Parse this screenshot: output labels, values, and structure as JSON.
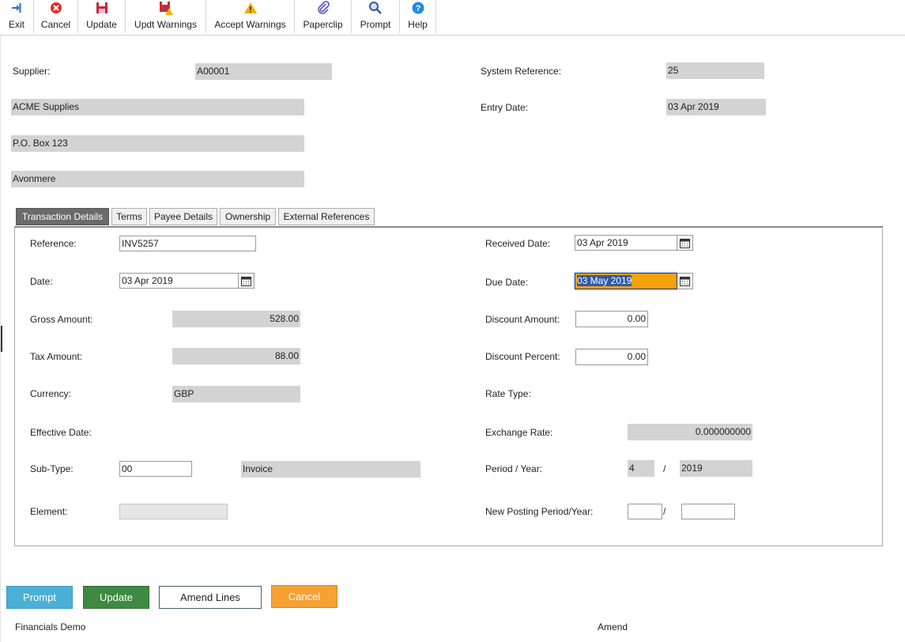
{
  "toolbar": {
    "exit": "Exit",
    "cancel": "Cancel",
    "update": "Update",
    "updt_warnings": "Updt Warnings",
    "accept_warnings": "Accept Warnings",
    "paperclip": "Paperclip",
    "prompt": "Prompt",
    "help": "Help",
    "icons": [
      "exit-arrow-icon",
      "cancel-x-icon",
      "save-disk-icon",
      "save-warning-icon",
      "warning-triangle-icon",
      "paperclip-icon",
      "magnifier-icon",
      "help-question-icon"
    ]
  },
  "header": {
    "supplier_label": "Supplier:",
    "supplier_code": "A00001",
    "supplier_name": "ACME Supplies",
    "address_line1": "P.O. Box 123",
    "address_line2": "Avonmere",
    "system_reference_label": "System Reference:",
    "system_reference": "25",
    "entry_date_label": "Entry Date:",
    "entry_date": "03 Apr 2019"
  },
  "tabs": [
    {
      "label": "Transaction Details",
      "active": true
    },
    {
      "label": "Terms"
    },
    {
      "label": "Payee Details"
    },
    {
      "label": "Ownership"
    },
    {
      "label": "External References"
    }
  ],
  "form": {
    "reference_label": "Reference:",
    "reference": "INV5257",
    "date_label": "Date:",
    "date": "03 Apr 2019",
    "gross_amount_label": "Gross Amount:",
    "gross_amount": "528.00",
    "tax_amount_label": "Tax Amount:",
    "tax_amount": "88.00",
    "currency_label": "Currency:",
    "currency": "GBP",
    "effective_date_label": "Effective Date:",
    "effective_date": "",
    "sub_type_label": "Sub-Type:",
    "sub_type": "00",
    "sub_type_desc": "Invoice",
    "element_label": "Element:",
    "element": "",
    "received_date_label": "Received Date:",
    "received_date": "03 Apr 2019",
    "due_date_label": "Due Date:",
    "due_date": "03 May 2019",
    "discount_amount_label": "Discount Amount:",
    "discount_amount": "0.00",
    "discount_percent_label": "Discount Percent:",
    "discount_percent": "0.00",
    "rate_type_label": "Rate Type:",
    "rate_type": "",
    "exchange_rate_label": "Exchange Rate:",
    "exchange_rate": "0.000000000",
    "period_year_label": "Period / Year:",
    "period": "4",
    "slash": "/",
    "year": "2019",
    "new_posting_label": "New Posting Period/Year:",
    "new_period": "",
    "new_year": ""
  },
  "buttons": {
    "prompt": "Prompt",
    "update": "Update",
    "amend_lines": "Amend Lines",
    "cancel": "Cancel"
  },
  "footer": {
    "app_name": "Financials Demo",
    "mode": "Amend"
  },
  "colors": {
    "prompt_button": "#4bafd8",
    "update_button": "#3f8a43",
    "cancel_button": "#f6a134",
    "active_tab": "#6b6b6b",
    "readonly_field": "#d3d3d3",
    "focus_field": "#f4a20a"
  }
}
